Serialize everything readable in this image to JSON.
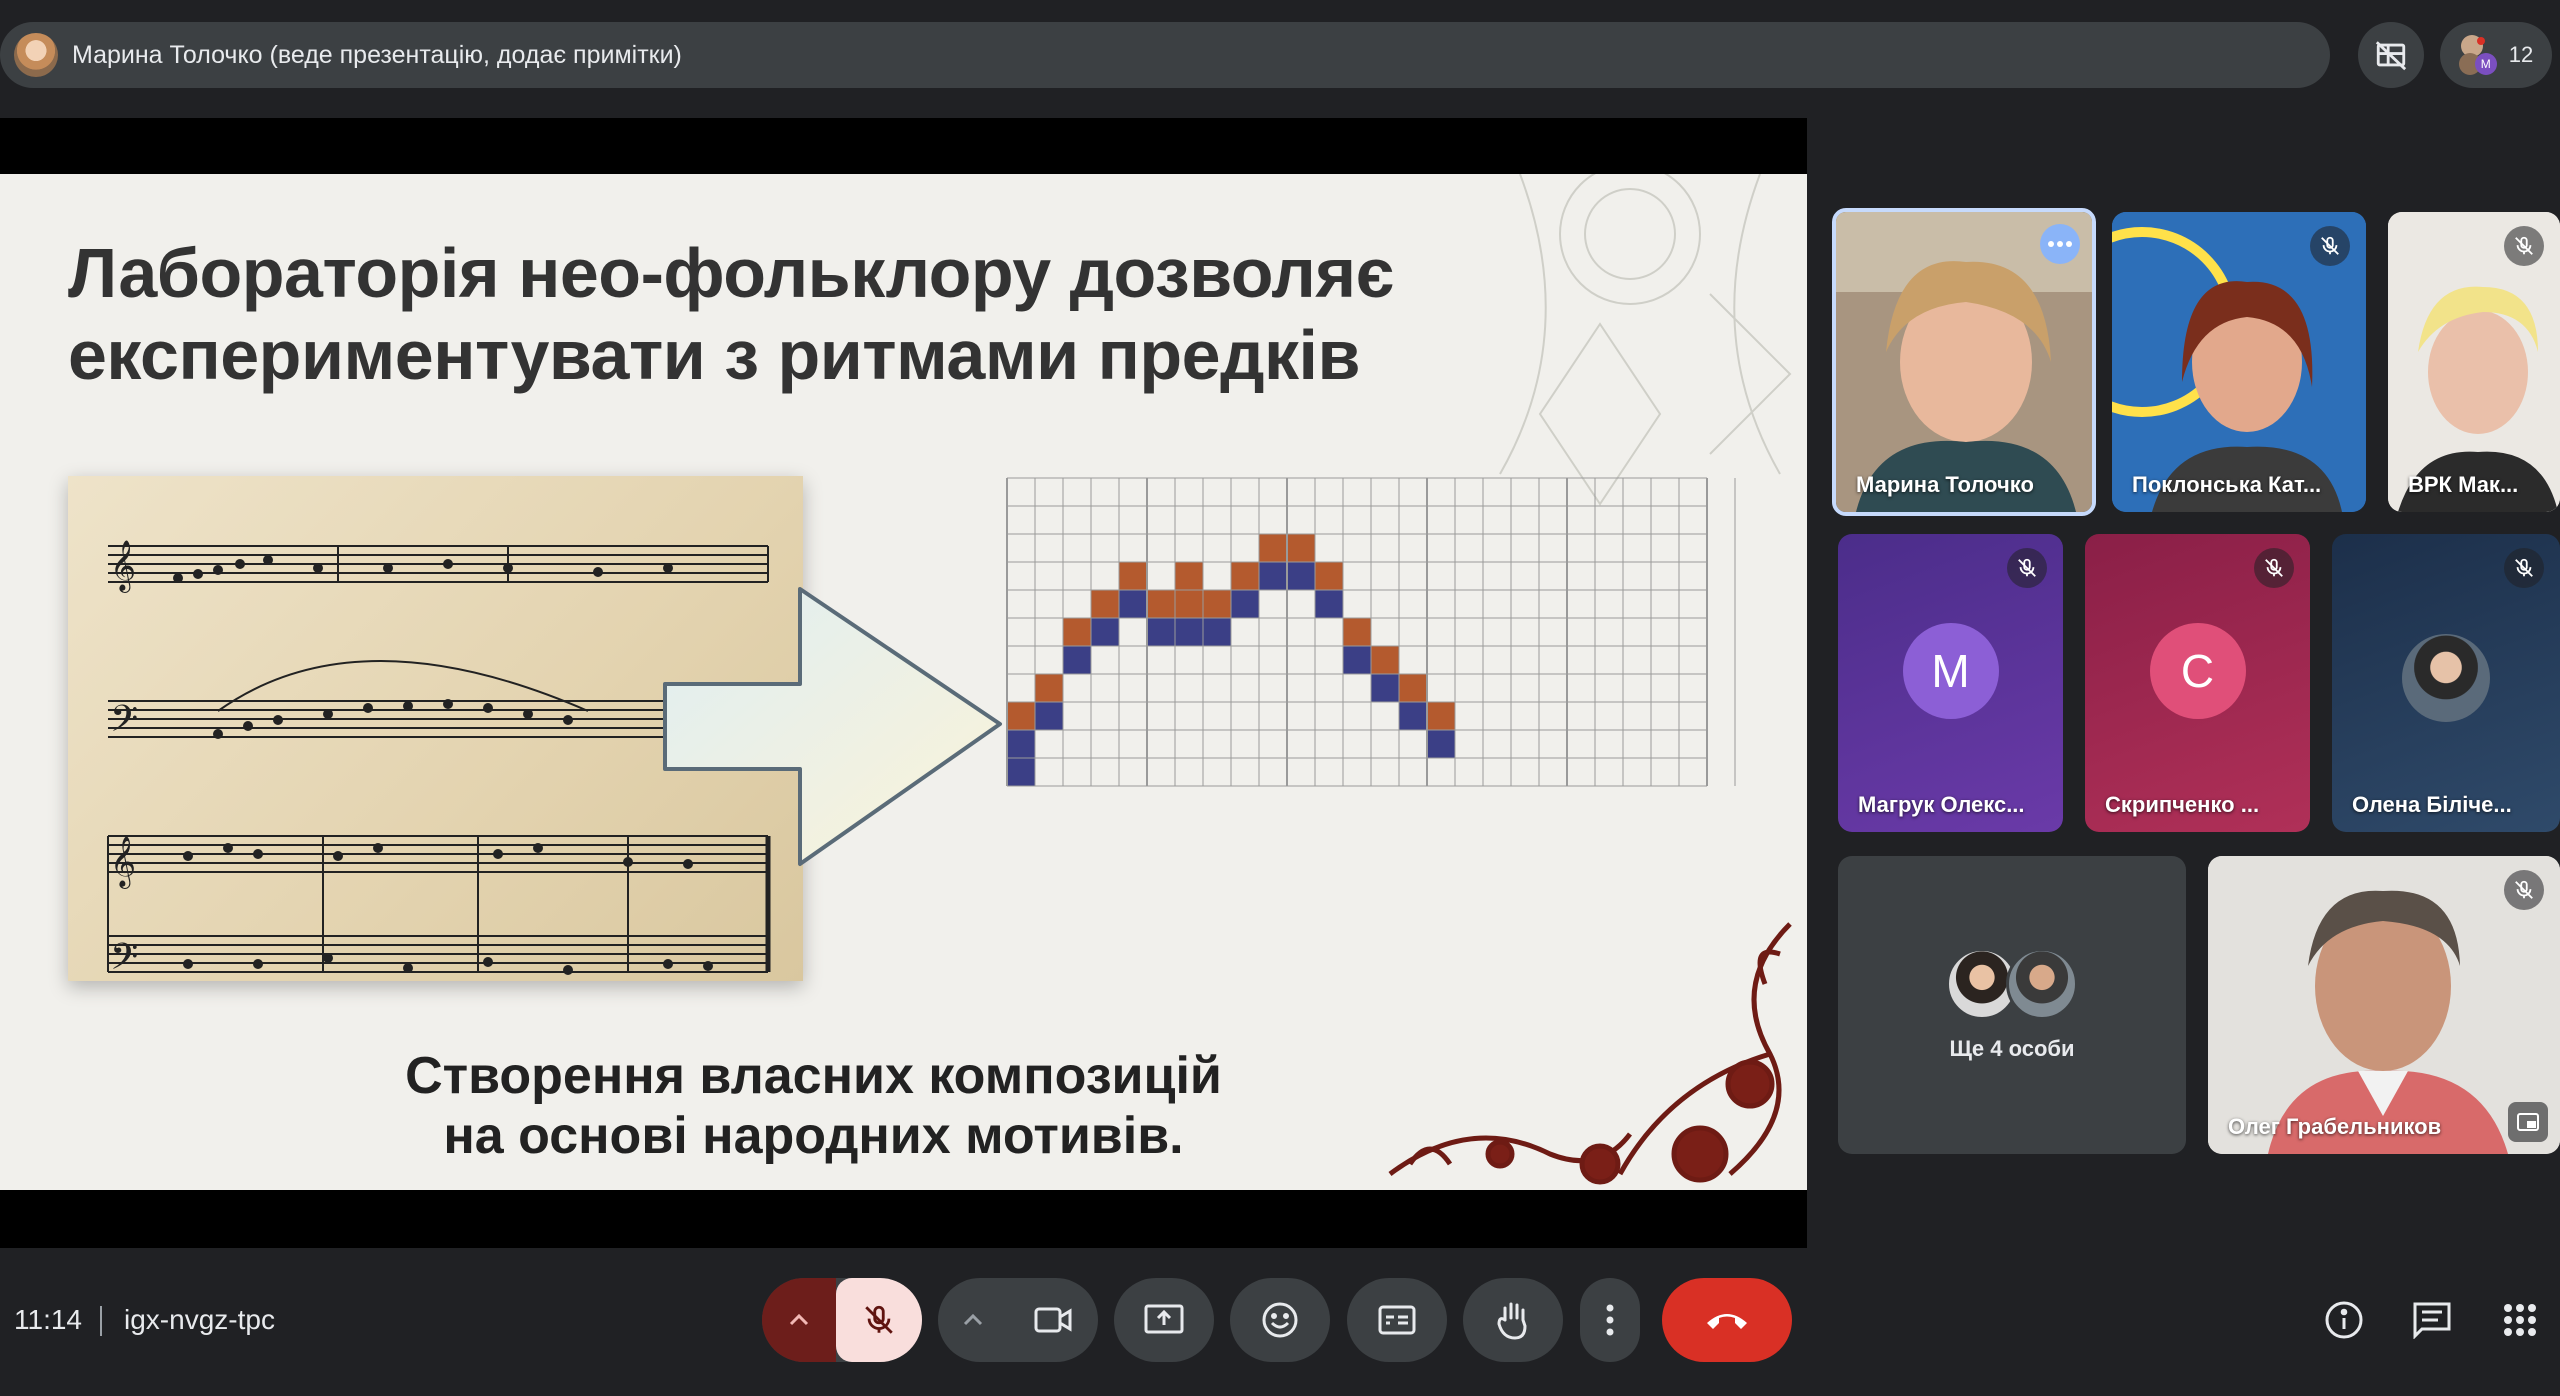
{
  "presenter_bar": {
    "text": "Марина Толочко (веде презентацію, додає примітки)"
  },
  "top_controls": {
    "participant_count": "12"
  },
  "slide": {
    "title_line1": "Лабораторія нео-фольклору дозволяє",
    "title_line2": "експериментувати з ритмами предків",
    "subtitle_line1": "Створення власних композицій",
    "subtitle_line2": "на основі народних мотивів.",
    "colors": {
      "orange": "#b45a2e",
      "blue": "#3b3f86",
      "grid_line": "#9a9a9a"
    }
  },
  "tiles": [
    {
      "id": "marina",
      "name": "Марина Толочко"
    },
    {
      "id": "poklonska",
      "name": "Поклонська Кат..."
    },
    {
      "id": "vrk",
      "name": "ВРК Мак..."
    },
    {
      "id": "mahruk",
      "name": "Магрук Олекс...",
      "letter": "М"
    },
    {
      "id": "skrypchenko",
      "name": "Скрипченко ...",
      "letter": "С"
    },
    {
      "id": "olena",
      "name": "Олена Біліче..."
    },
    {
      "id": "more",
      "name": "Ще 4 особи"
    },
    {
      "id": "oleg",
      "name": "Олег Грабельников"
    }
  ],
  "bottom_bar": {
    "time": "11:14",
    "meeting_code": "igx-nvgz-tpc"
  },
  "accent_colors": {
    "leave": "#d93025",
    "mic_off_bg": "#f9dedc",
    "mic_expand_bg": "#6d1e1b",
    "active_speaker_border": "#c6dafc"
  }
}
